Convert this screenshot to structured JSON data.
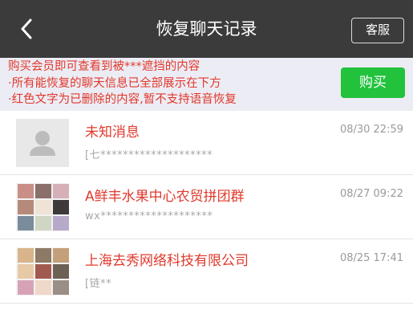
{
  "header": {
    "title": "恢复聊天记录",
    "service_label": "客服"
  },
  "notice": {
    "lines": [
      "购买会员即可查看到被***遮挡的内容",
      "·所有能恢复的聊天信息已全部展示在下方",
      "·红色文字为已删除的内容,暂不支持语音恢复"
    ],
    "buy_label": "购买",
    "text_color": "#e2382b",
    "button_color": "#22c23d"
  },
  "chats": [
    {
      "name": "未知消息",
      "preview": "[七********************",
      "time": "08/30 22:59",
      "avatar": "default-user-icon"
    },
    {
      "name": "A鲜丰水果中心农贸拼团群",
      "preview": "wx********************",
      "time": "08/27 09:22",
      "avatar": "group-avatar-grid"
    },
    {
      "name": "上海去秀网络科技有限公司",
      "preview": "[链**",
      "time": "08/25 17:41",
      "avatar": "group-avatar-grid"
    }
  ]
}
